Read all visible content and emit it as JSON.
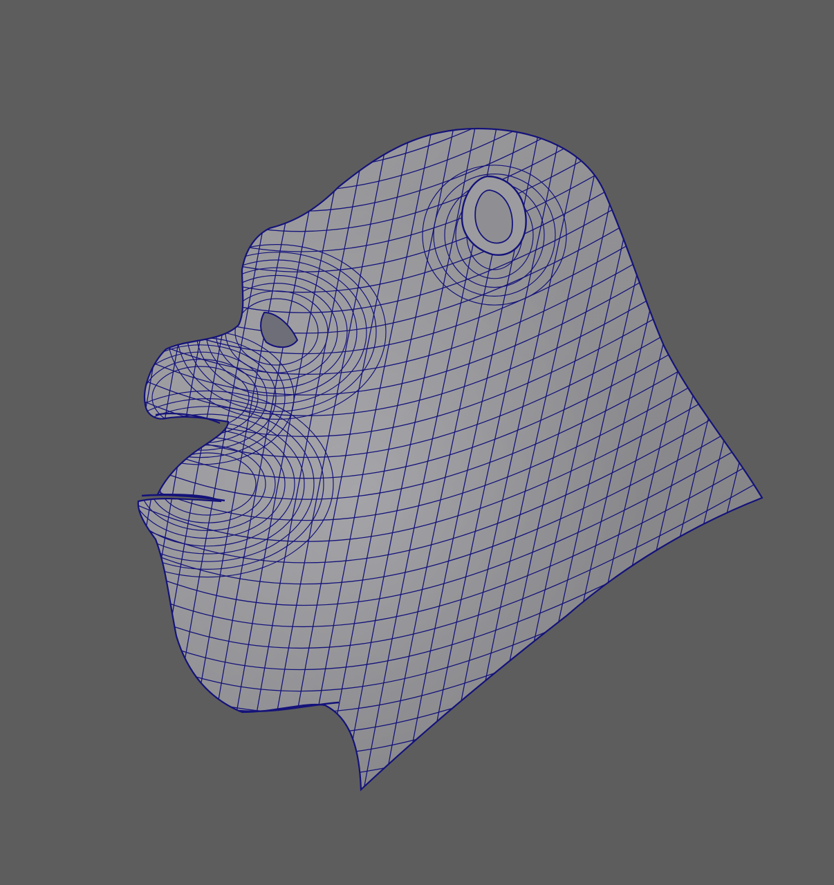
{
  "viewport": {
    "background_color": "#5d5d5d",
    "model": {
      "subject": "head-sculpt",
      "display": "wireframe-on-shaded",
      "surface_color": "#a3a3a7",
      "wire_color": "#14127a"
    }
  }
}
